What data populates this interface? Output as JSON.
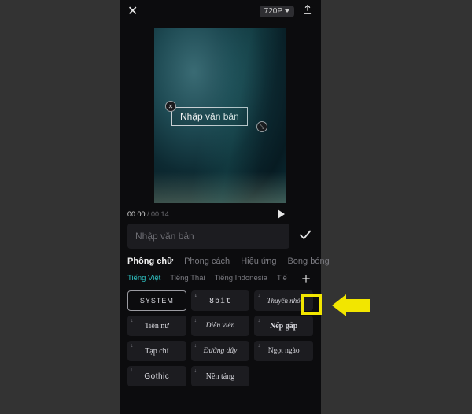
{
  "topbar": {
    "resolution_label": "720P"
  },
  "preview": {
    "text_placeholder": "Nhập văn bản"
  },
  "playback": {
    "current": "00:00",
    "sep": " / ",
    "duration": "00:14"
  },
  "input": {
    "placeholder": "Nhập văn bản"
  },
  "main_tabs": [
    {
      "label": "Phông chữ",
      "active": true
    },
    {
      "label": "Phong cách",
      "active": false
    },
    {
      "label": "Hiệu ứng",
      "active": false
    },
    {
      "label": "Bong bóng",
      "active": false
    }
  ],
  "lang_tabs": [
    {
      "label": "Tiếng Việt",
      "active": true
    },
    {
      "label": "Tiếng Thái",
      "active": false
    },
    {
      "label": "Tiếng Indonesia",
      "active": false
    },
    {
      "label": "Tiế",
      "active": false,
      "cut": true
    }
  ],
  "fonts": [
    {
      "label": "SYSTEM",
      "selected": true,
      "cls": ""
    },
    {
      "label": "8bit",
      "selected": false,
      "cls": "f-8bit"
    },
    {
      "label": "Thuyền nhỏ",
      "selected": false,
      "cls": "f-thuyen"
    },
    {
      "label": "Tiên nữ",
      "selected": false,
      "cls": "f-tien"
    },
    {
      "label": "Diễn viên",
      "selected": false,
      "cls": "f-dien"
    },
    {
      "label": "Nếp gấp",
      "selected": false,
      "cls": "f-nep"
    },
    {
      "label": "Tạp chí",
      "selected": false,
      "cls": "f-tap"
    },
    {
      "label": "Đường dây",
      "selected": false,
      "cls": "f-duong"
    },
    {
      "label": "Ngọt ngào",
      "selected": false,
      "cls": "f-ngot"
    },
    {
      "label": "Gothic",
      "selected": false,
      "cls": "f-gothic"
    },
    {
      "label": "Nền tảng",
      "selected": false,
      "cls": "f-nen"
    }
  ]
}
